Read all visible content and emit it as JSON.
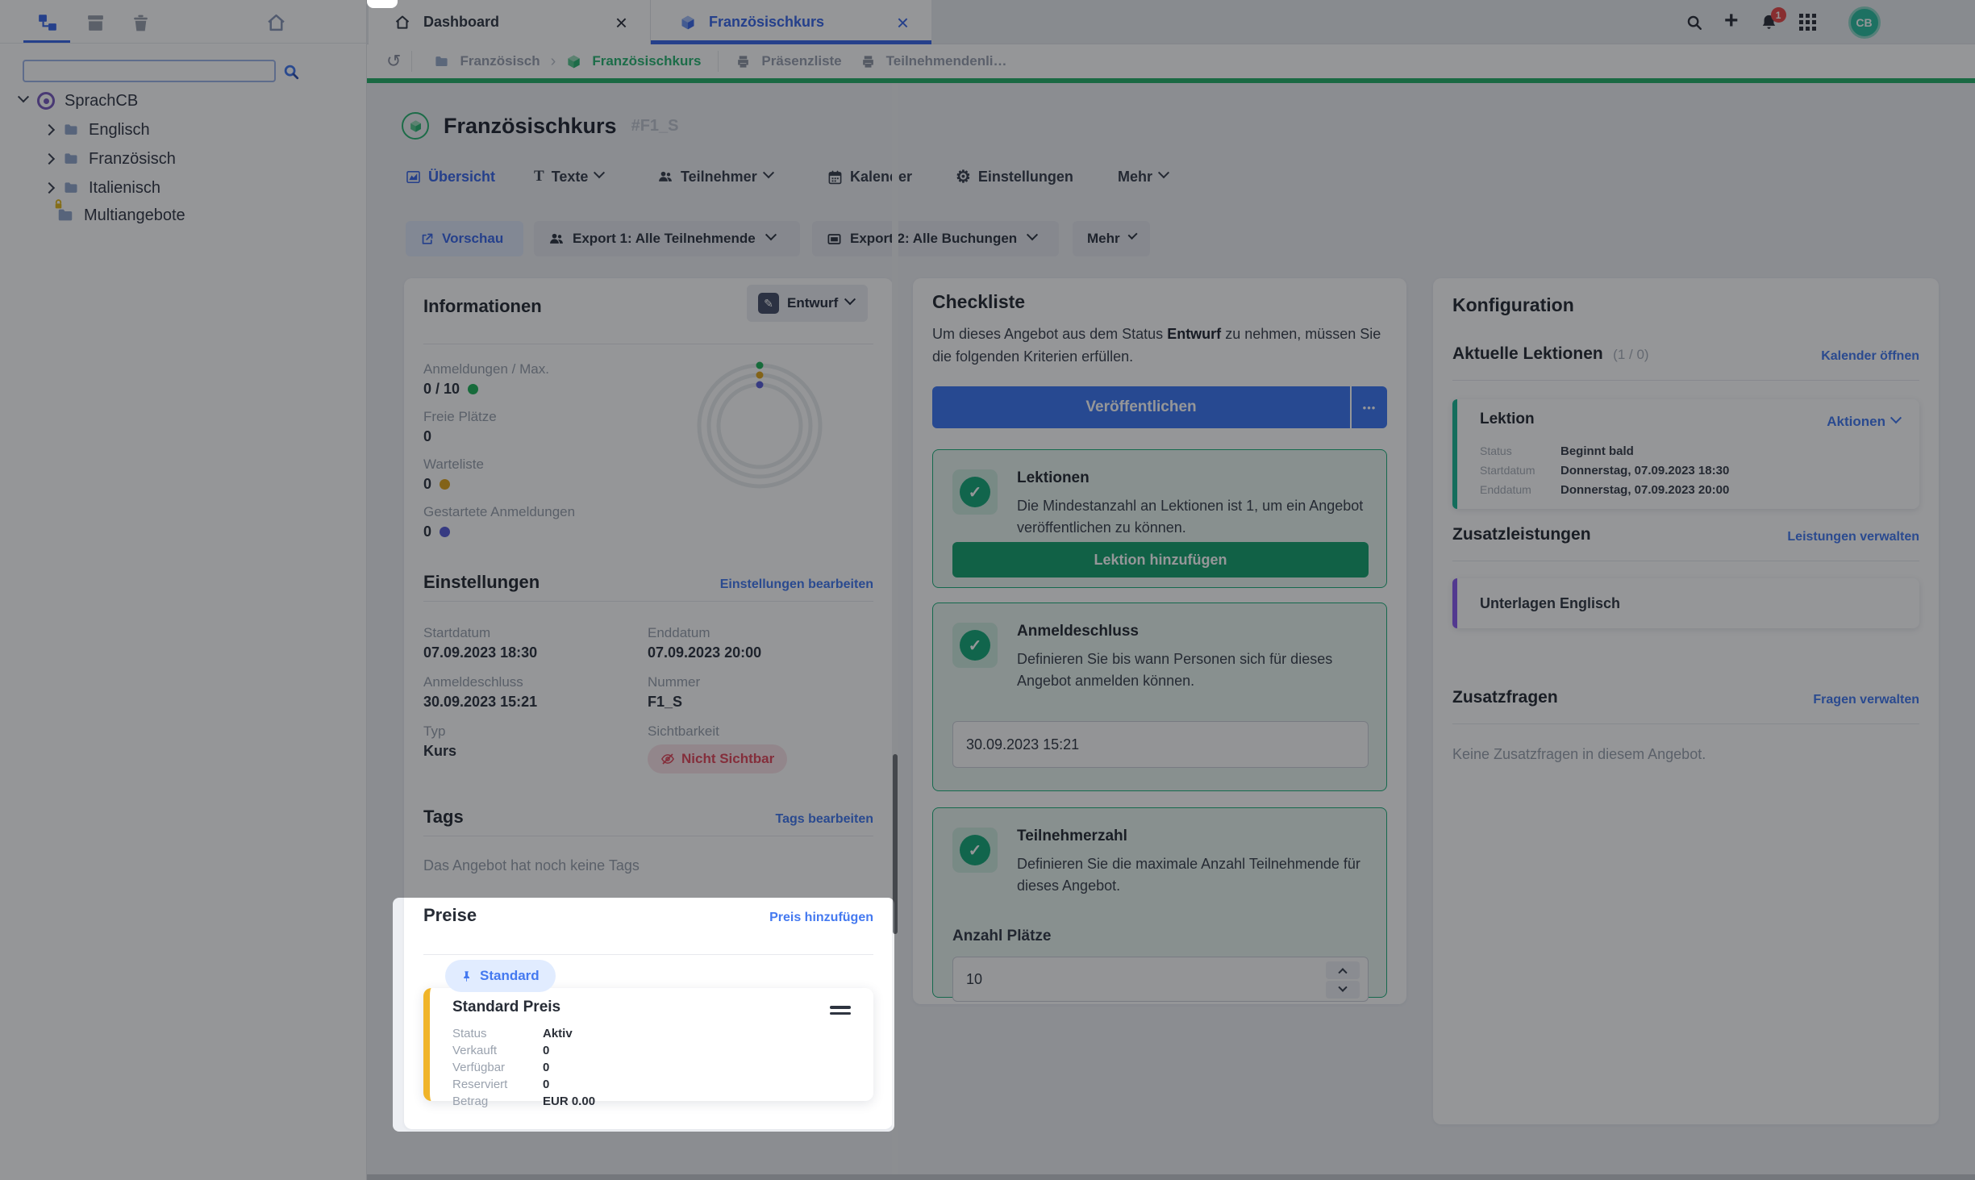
{
  "window": {
    "tabs": [
      {
        "label": "Dashboard",
        "close": "×"
      },
      {
        "label": "Französischkurs",
        "close": "×"
      }
    ],
    "topbar": {
      "notification_count": "1",
      "avatar_initials": "CB"
    }
  },
  "breadcrumb": {
    "history_icon": "↺",
    "items": [
      "Französisch",
      "Französischkurs",
      "Präsenzliste",
      "Teilnehmendenli…"
    ],
    "separator": "›"
  },
  "sidebar": {
    "search_placeholder": "",
    "tree": [
      {
        "label": "SprachCB"
      },
      {
        "label": "Englisch"
      },
      {
        "label": "Französisch"
      },
      {
        "label": "Italienisch"
      },
      {
        "label": "Multiangebote"
      }
    ]
  },
  "page": {
    "title": "Französischkurs",
    "code": "#F1_S",
    "tabs": [
      "Übersicht",
      "Texte",
      "Teilnehmer",
      "Kalender",
      "Einstellungen",
      "Mehr"
    ],
    "actions": {
      "preview": "Vorschau",
      "export1": "Export 1: Alle Teilnehmende",
      "export2": "Export 2: Alle Buchungen",
      "more": "Mehr"
    }
  },
  "info": {
    "title": "Informationen",
    "status_button": "Entwurf",
    "pencil_glyph": "✎",
    "stats": [
      {
        "label": "Anmeldungen / Max.",
        "value": "0 / 10"
      },
      {
        "label": "Freie Plätze",
        "value": "0"
      },
      {
        "label": "Warteliste",
        "value": "0"
      },
      {
        "label": "Gestartete Anmeldungen",
        "value": "0"
      }
    ],
    "settings": {
      "title": "Einstellungen",
      "edit_link": "Einstellungen bearbeiten",
      "fields": [
        {
          "label": "Startdatum",
          "value": "07.09.2023 18:30"
        },
        {
          "label": "Enddatum",
          "value": "07.09.2023 20:00"
        },
        {
          "label": "Anmeldeschluss",
          "value": "30.09.2023 15:21"
        },
        {
          "label": "Nummer",
          "value": "F1_S"
        },
        {
          "label": "Typ",
          "value": "Kurs"
        },
        {
          "label": "Sichtbarkeit",
          "value": "Nicht Sichtbar"
        }
      ]
    },
    "tags": {
      "title": "Tags",
      "edit_link": "Tags bearbeiten",
      "empty_text": "Das Angebot hat noch keine Tags"
    },
    "preise": {
      "title": "Preise",
      "add_link": "Preis hinzufügen",
      "badge": "Standard",
      "card_title": "Standard Preis",
      "rows": [
        {
          "label": "Status",
          "value": "Aktiv"
        },
        {
          "label": "Verkauft",
          "value": "0"
        },
        {
          "label": "Verfügbar",
          "value": "0"
        },
        {
          "label": "Reserviert",
          "value": "0"
        },
        {
          "label": "Betrag",
          "value": "EUR 0.00"
        }
      ]
    }
  },
  "checkliste": {
    "title": "Checkliste",
    "intro_before": "Um dieses Angebot aus dem Status",
    "intro_bold": "Entwurf",
    "intro_after": "zu nehmen, müssen Sie die folgenden Kriterien erfüllen.",
    "publish_button": "Veröffentlichen",
    "publish_more": "•••",
    "check_glyph": "✓",
    "items": [
      {
        "title": "Lektionen",
        "text": "Die Mindestanzahl an Lektionen ist 1, um ein Angebot veröffentlichen zu können.",
        "button": "Lektion hinzufügen"
      },
      {
        "title": "Anmeldeschluss",
        "text": "Definieren Sie bis wann Personen sich für dieses Angebot anmelden können.",
        "input_value": "30.09.2023 15:21"
      },
      {
        "title": "Teilnehmerzahl",
        "text": "Definieren Sie die maximale Anzahl Teilnehmende für dieses Angebot.",
        "input_label": "Anzahl Plätze",
        "input_value": "10"
      }
    ]
  },
  "konfiguration": {
    "title": "Konfiguration",
    "lektionen": {
      "title": "Aktuelle Lektionen",
      "count": "(1 / 0)",
      "link": "Kalender öffnen",
      "card": {
        "title": "Lektion",
        "menu": "Aktionen",
        "rows": [
          {
            "label": "Status",
            "value": "Beginnt bald"
          },
          {
            "label": "Startdatum",
            "value": "Donnerstag, 07.09.2023 18:30"
          },
          {
            "label": "Enddatum",
            "value": "Donnerstag, 07.09.2023 20:00"
          }
        ]
      }
    },
    "zusatzleistungen": {
      "title": "Zusatzleistungen",
      "link": "Leistungen verwalten",
      "item": "Unterlagen Englisch"
    },
    "zusatzfragen": {
      "title": "Zusatzfragen",
      "link": "Fragen verwalten",
      "empty_text": "Keine Zusatzfragen in diesem Angebot."
    }
  },
  "colors": {
    "primary_blue": "#3b68e8",
    "link_blue": "#4479f0",
    "publish_blue": "#3e78f2",
    "green_button": "#17a370",
    "green_border": "#1fb07c",
    "check_green": "#17a97a",
    "topbar_line_green": "#28b06a",
    "breadcrumb_green": "#2bb673",
    "stat_green": "#22b35c",
    "amber": "#e0a51e",
    "indigo": "#5a5fd8",
    "price_yellow": "#f0b429",
    "purple_bar": "#8a5cf0",
    "teal_bar": "#1cb896",
    "red_badge_text": "#e2495c",
    "avatar_teal": "#2dbfa0",
    "notification_red": "#e94848"
  }
}
